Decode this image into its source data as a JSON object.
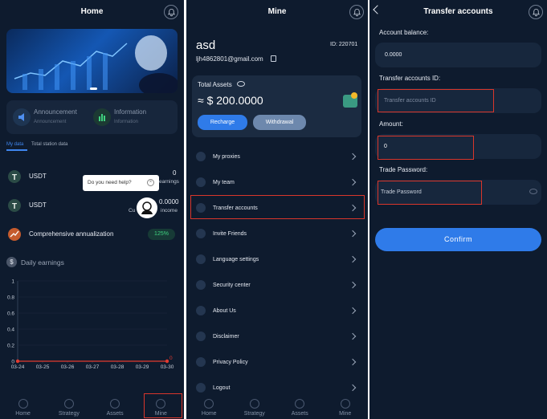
{
  "colors": {
    "bg": "#0e1b2e",
    "card": "#17263c",
    "accent": "#2f7be9",
    "highlight": "#d9362b",
    "green": "#3fd27f",
    "red": "#e23a2f"
  },
  "home": {
    "title": "Home",
    "announcement_title": "Announcement",
    "announcement_sub": "Announcement",
    "information_title": "Information",
    "information_sub": "Information",
    "tab_my": "My data",
    "tab_total": "Total station data",
    "row1_label": "USDT",
    "row1_value": "0",
    "row1_sub": "earnings",
    "row2_label": "USDT",
    "row2_value": "0.0000",
    "row2_sub_left": "Cu",
    "row2_sub_right": "income",
    "row3_label": "Comprehensive annualization",
    "row3_value": "125%",
    "help_text": "Do you need help?",
    "daily_title": "Daily earnings",
    "y_ticks": [
      "1",
      "0.8",
      "0.6",
      "0.4",
      "0.2",
      "0"
    ],
    "x_ticks": [
      "03-24",
      "03-25",
      "03-26",
      "03-27",
      "03-28",
      "03-29",
      "03-30"
    ],
    "end_value": "0"
  },
  "chart_data": {
    "type": "line",
    "title": "Daily earnings",
    "x": [
      "03-24",
      "03-25",
      "03-26",
      "03-27",
      "03-28",
      "03-29",
      "03-30"
    ],
    "series": [
      {
        "values": [
          0,
          0,
          0,
          0,
          0,
          0,
          0
        ]
      }
    ],
    "ylim": [
      0,
      1
    ]
  },
  "nav": {
    "home": "Home",
    "strategy": "Strategy",
    "assets": "Assets",
    "mine": "Mine"
  },
  "mine": {
    "title": "Mine",
    "username": "asd",
    "id_label": "ID: 220701",
    "email": "ljh4862801@gmail.com",
    "total_assets_label": "Total Assets",
    "total_assets_value": "≈ $ 200.0000",
    "recharge": "Recharge",
    "withdrawal": "Withdrawal",
    "menu": [
      "My proxies",
      "My team",
      "Transfer accounts",
      "Invite Friends",
      "Language settings",
      "Security center",
      "About Us",
      "Disclaimer",
      "Privacy Policy",
      "Logout"
    ]
  },
  "transfer": {
    "title": "Transfer accounts",
    "balance_label": "Account balance:",
    "balance_value": "0.0000",
    "id_label": "Transfer accounts ID:",
    "id_placeholder": "Transfer accounts ID",
    "amount_label": "Amount:",
    "amount_value": "0",
    "password_label": "Trade Password:",
    "password_placeholder": "Trade Password",
    "confirm": "Confirm"
  }
}
